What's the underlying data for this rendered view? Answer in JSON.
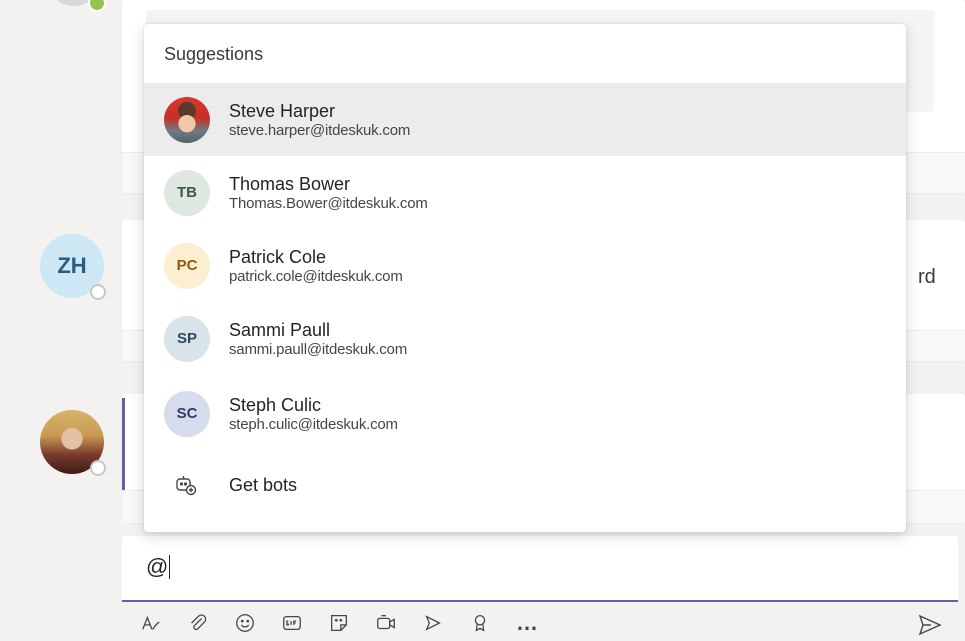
{
  "popup": {
    "title": "Suggestions",
    "suggestions": [
      {
        "name": "Steve Harper",
        "email": "steve.harper@itdeskuk.com",
        "initials": "",
        "selected": true
      },
      {
        "name": "Thomas Bower",
        "email": "Thomas.Bower@itdeskuk.com",
        "initials": "TB",
        "selected": false
      },
      {
        "name": "Patrick Cole",
        "email": "patrick.cole@itdeskuk.com",
        "initials": "PC",
        "selected": false
      },
      {
        "name": "Sammi Paull",
        "email": "sammi.paull@itdeskuk.com",
        "initials": "SP",
        "selected": false
      },
      {
        "name": "Steph Culic",
        "email": "steph.culic@itdeskuk.com",
        "initials": "SC",
        "selected": false
      }
    ],
    "bots_label": "Get bots",
    "bots_icon": "bot-add-icon"
  },
  "chat": {
    "avatar_initials": "ZH",
    "partial_text": "rd"
  },
  "compose": {
    "value": "@"
  },
  "toolbar": {
    "icons": [
      "format-icon",
      "attach-icon",
      "emoji-icon",
      "gif-icon",
      "sticker-icon",
      "meet-now-icon",
      "stream-icon",
      "praise-icon",
      "more-options-icon"
    ],
    "more_label": "…",
    "send_icon": "send-icon"
  },
  "colors": {
    "accent": "#6264a7",
    "online": "#92c353"
  }
}
